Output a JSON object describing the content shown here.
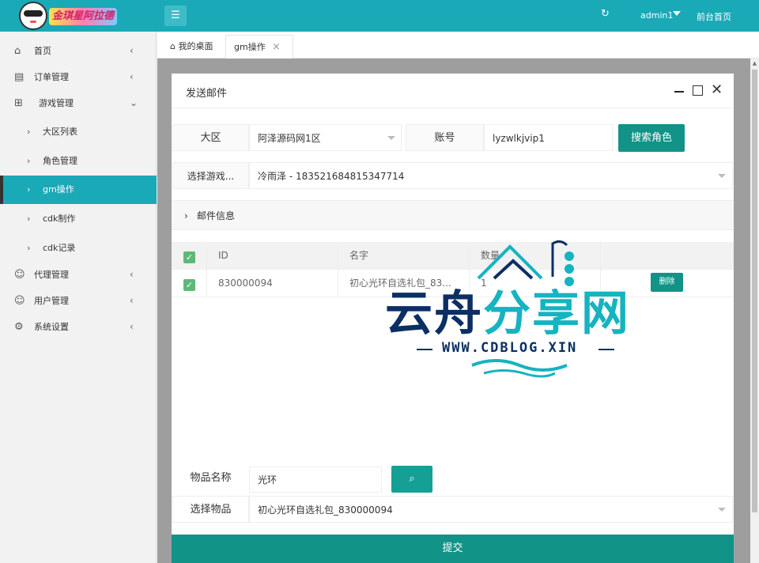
{
  "header": {
    "logo_text": "金琪星阿拉德",
    "user": "admin1",
    "front_link": "前台首页",
    "icons": {
      "menu": "menu-icon",
      "refresh": "refresh-icon"
    }
  },
  "sidebar": {
    "items": [
      {
        "label": "首页",
        "icon": "home-icon"
      },
      {
        "label": "订单管理",
        "icon": "order-icon"
      },
      {
        "label": "游戏管理",
        "icon": "game-icon"
      },
      {
        "label": "大区列表",
        "icon": "chevron-right-icon"
      },
      {
        "label": "角色管理",
        "icon": "chevron-right-icon"
      },
      {
        "label": "gm操作",
        "icon": "chevron-right-icon",
        "active": true
      },
      {
        "label": "cdk制作",
        "icon": "chevron-right-icon"
      },
      {
        "label": "cdk记录",
        "icon": "chevron-right-icon"
      },
      {
        "label": "代理管理",
        "icon": "agent-icon"
      },
      {
        "label": "用户管理",
        "icon": "user-icon"
      },
      {
        "label": "系统设置",
        "icon": "gear-icon"
      }
    ]
  },
  "tabs": [
    {
      "label": "我的桌面"
    },
    {
      "label": "gm操作",
      "active": true
    }
  ],
  "modal": {
    "title": "发送邮件",
    "region_label": "大区",
    "region_value": "阿泽源码网1区",
    "account_label": "账号",
    "account_value": "lyzwlkjvip1",
    "search_role_button": "搜索角色",
    "role_label": "选择游戏...",
    "role_value": "冷雨泽 - 183521684815347714",
    "mail_info": "邮件信息",
    "table": {
      "headers": [
        "ID",
        "名字",
        "数量"
      ],
      "rows": [
        {
          "id": "830000094",
          "name": "初心光环自选礼包_83...",
          "qty": "1",
          "delete": "删除"
        }
      ]
    },
    "item_name_label": "物品名称",
    "item_name_value": "光环",
    "select_item_label": "选择物品",
    "select_item_value": "初心光环自选礼包_830000094",
    "submit": "提交"
  },
  "watermark": {
    "part1": "云舟",
    "part2": "分享网",
    "url": "WWW.CDBLOG.XIN"
  },
  "colors": {
    "topbar": "#1aa9b7",
    "primary_button": "#129387",
    "checkbox": "#5fb878",
    "watermark_navy": "#0c2f63",
    "watermark_cyan": "#16b3c0"
  }
}
